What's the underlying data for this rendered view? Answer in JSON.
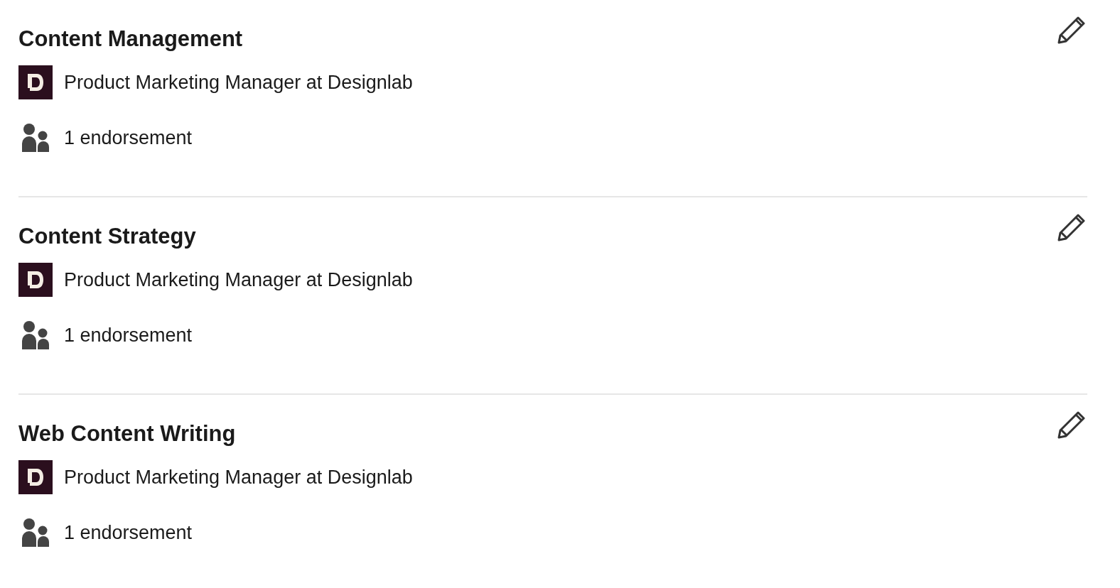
{
  "skills": [
    {
      "name": "Content Management",
      "experience": "Product Marketing Manager at Designlab",
      "endorsements": "1 endorsement"
    },
    {
      "name": "Content Strategy",
      "experience": "Product Marketing Manager at Designlab",
      "endorsements": "1 endorsement"
    },
    {
      "name": "Web Content Writing",
      "experience": "Product Marketing Manager at Designlab",
      "endorsements": "1 endorsement"
    }
  ]
}
